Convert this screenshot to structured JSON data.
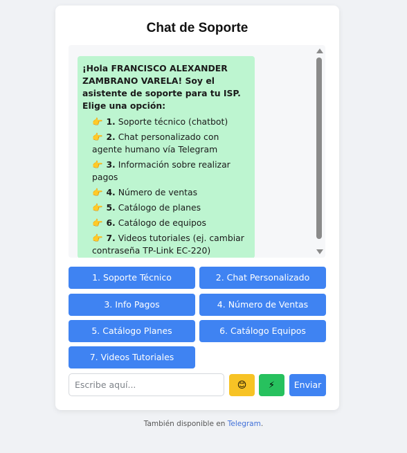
{
  "title": "Chat de Soporte",
  "chat": {
    "intro": "¡Hola FRANCISCO ALEXANDER ZAMBRANO VARELA! Soy el asistente de soporte para tu ISP. Elige una opción:",
    "options": [
      {
        "num": "1.",
        "text": "Soporte técnico (chatbot)"
      },
      {
        "num": "2.",
        "text": "Chat personalizado con agente humano vía Telegram"
      },
      {
        "num": "3.",
        "text": "Información sobre realizar pagos"
      },
      {
        "num": "4.",
        "text": "Número de ventas"
      },
      {
        "num": "5.",
        "text": "Catálogo de planes"
      },
      {
        "num": "6.",
        "text": "Catálogo de equipos"
      },
      {
        "num": "7.",
        "text": "Videos tutoriales (ej. cambiar contraseña TP-Link EC-220) Responde con el número de la opción."
      }
    ],
    "pointer_icon": "👉"
  },
  "quick_buttons": [
    "1. Soporte Técnico",
    "2. Chat Personalizado",
    "3. Info Pagos",
    "4. Número de Ventas",
    "5. Catálogo Planes",
    "6. Catálogo Equipos",
    "7. Videos Tutoriales"
  ],
  "input": {
    "placeholder": "Escribe aquí...",
    "value": ""
  },
  "emoji_button_icon": "😊",
  "bolt_button_icon": "⚡",
  "send_label": "Enviar",
  "footer": {
    "text": "También disponible en",
    "link": "Telegram",
    "suffix": "."
  },
  "colors": {
    "accent": "#3f83f2",
    "bubble": "#bdf5d0",
    "emoji_button": "#f7c325",
    "bolt_button": "#27c15e"
  }
}
